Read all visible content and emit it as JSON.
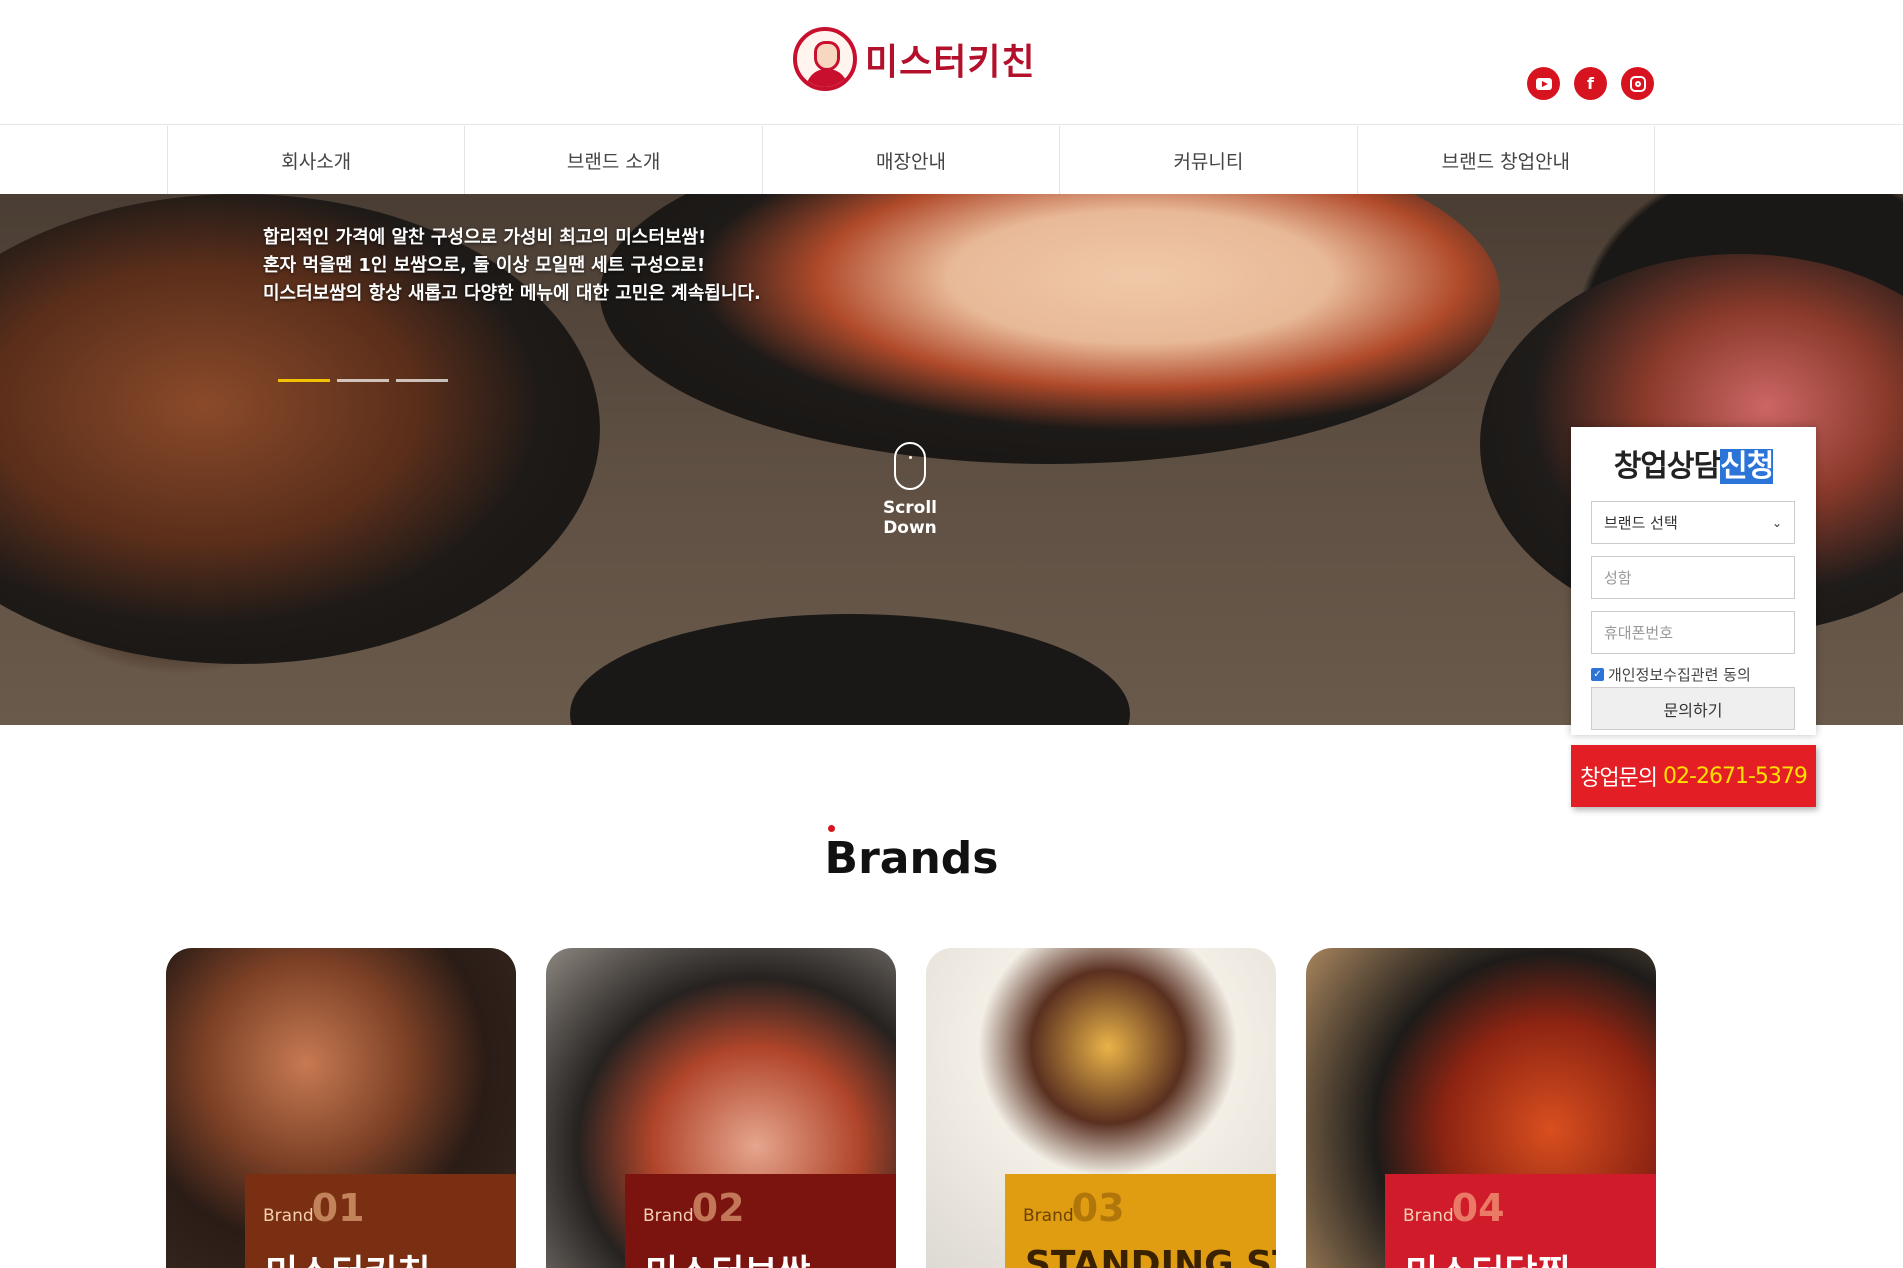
{
  "header": {
    "logo_text": "미스터키친",
    "social": [
      "youtube-icon",
      "facebook-icon",
      "instagram-icon"
    ]
  },
  "nav": {
    "items": [
      {
        "label": "회사소개"
      },
      {
        "label": "브랜드 소개"
      },
      {
        "label": "매장안내"
      },
      {
        "label": "커뮤니티"
      },
      {
        "label": "브랜드 창업안내"
      }
    ]
  },
  "hero": {
    "lines": [
      "합리적인 가격에 알찬 구성으로 가성비 최고의 미스터보쌈!",
      "혼자 먹을땐 1인 보쌈으로, 둘 이상 모일땐 세트 구성으로!",
      "미스터보쌈의 항상 새롭고 다양한 메뉴에 대한 고민은 계속됩니다."
    ],
    "slider_count": 3,
    "slider_active": 1,
    "scroll_label": "Scroll Down"
  },
  "consult": {
    "title_main": "창업상담",
    "title_highlight": "신청",
    "brand_select": "브랜드 선택",
    "name_placeholder": "성함",
    "phone_placeholder": "휴대폰번호",
    "agree_label": "개인정보수집관련 동의",
    "agree_checked": true,
    "submit_label": "문의하기"
  },
  "phone_banner": {
    "label": "창업문의",
    "number": "02-2671-5379"
  },
  "brands": {
    "title": "Brands",
    "cards": [
      {
        "word": "Brand",
        "num": "01",
        "name": "미스터키친"
      },
      {
        "word": "Brand",
        "num": "02",
        "name": "미스터보쌈"
      },
      {
        "word": "Brand",
        "num": "03",
        "name": "STANDING STEAK"
      },
      {
        "word": "Brand",
        "num": "04",
        "name": "미스터닭찜"
      }
    ]
  },
  "colors": {
    "brand_red": "#d7131f",
    "highlight_blue": "#2c74d8",
    "phone_yellow": "#ffe100"
  }
}
